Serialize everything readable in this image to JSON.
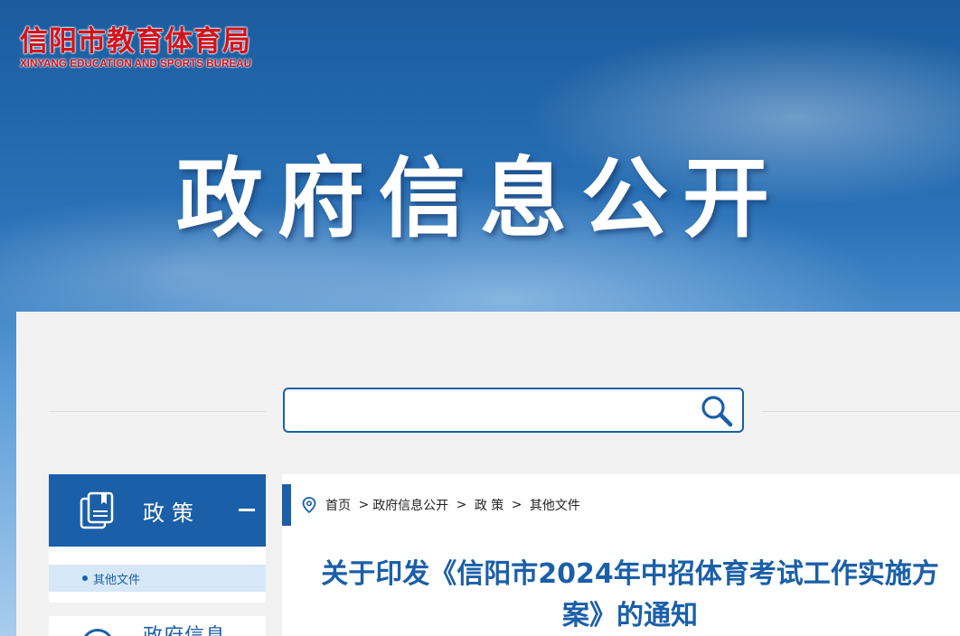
{
  "header": {
    "logo_cn": "信阳市教育体育局",
    "logo_en": "XINYANG EDUCATION AND SPORTS BUREAU",
    "banner_title": "政府信息公开"
  },
  "search": {
    "placeholder": "",
    "value": ""
  },
  "sidebar": {
    "section_title": "政策",
    "items": [
      {
        "label": "其他文件"
      }
    ],
    "next_section_title": "政府信息"
  },
  "breadcrumb": {
    "items": [
      "首页",
      "政府信息公开",
      "政 策",
      "其他文件"
    ]
  },
  "article": {
    "title": "关于印发《信阳市2024年中招体育考试工作实施方案》的通知"
  },
  "colors": {
    "brand_blue": "#1a5fa8",
    "logo_red": "#d2131b",
    "active_item_bg": "#d6e8f7"
  }
}
